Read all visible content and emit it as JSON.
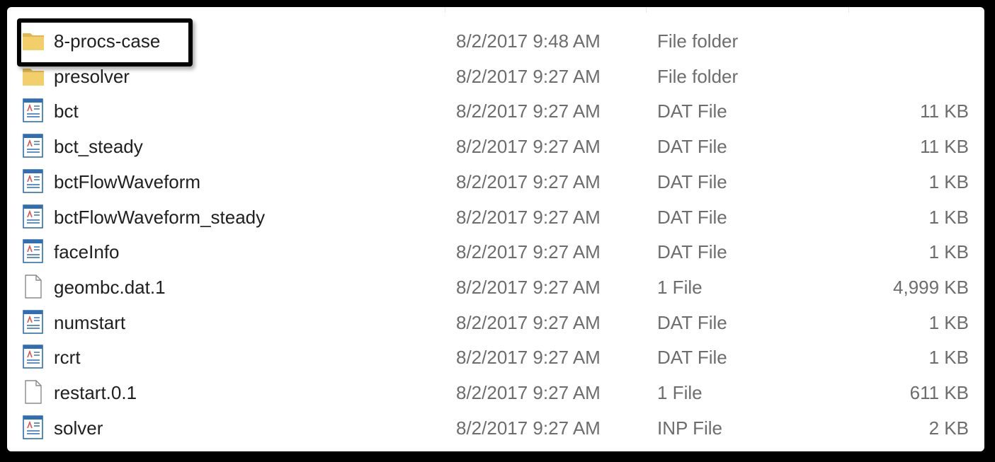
{
  "files": [
    {
      "name": "8-procs-case",
      "date": "8/2/2017 9:48 AM",
      "type": "File folder",
      "size": "",
      "icon": "folder-icon",
      "selected": true
    },
    {
      "name": "presolver",
      "date": "8/2/2017 9:27 AM",
      "type": "File folder",
      "size": "",
      "icon": "folder-icon"
    },
    {
      "name": "bct",
      "date": "8/2/2017 9:27 AM",
      "type": "DAT File",
      "size": "11 KB",
      "icon": "dat-file-icon"
    },
    {
      "name": "bct_steady",
      "date": "8/2/2017 9:27 AM",
      "type": "DAT File",
      "size": "11 KB",
      "icon": "dat-file-icon"
    },
    {
      "name": "bctFlowWaveform",
      "date": "8/2/2017 9:27 AM",
      "type": "DAT File",
      "size": "1 KB",
      "icon": "dat-file-icon"
    },
    {
      "name": "bctFlowWaveform_steady",
      "date": "8/2/2017 9:27 AM",
      "type": "DAT File",
      "size": "1 KB",
      "icon": "dat-file-icon"
    },
    {
      "name": "faceInfo",
      "date": "8/2/2017 9:27 AM",
      "type": "DAT File",
      "size": "1 KB",
      "icon": "dat-file-icon"
    },
    {
      "name": "geombc.dat.1",
      "date": "8/2/2017 9:27 AM",
      "type": "1 File",
      "size": "4,999 KB",
      "icon": "blank-file-icon"
    },
    {
      "name": "numstart",
      "date": "8/2/2017 9:27 AM",
      "type": "DAT File",
      "size": "1 KB",
      "icon": "dat-file-icon"
    },
    {
      "name": "rcrt",
      "date": "8/2/2017 9:27 AM",
      "type": "DAT File",
      "size": "1 KB",
      "icon": "dat-file-icon"
    },
    {
      "name": "restart.0.1",
      "date": "8/2/2017 9:27 AM",
      "type": "1 File",
      "size": "611 KB",
      "icon": "blank-file-icon"
    },
    {
      "name": "solver",
      "date": "8/2/2017 9:27 AM",
      "type": "INP File",
      "size": "2 KB",
      "icon": "inp-file-icon"
    }
  ],
  "colors": {
    "text": "#202020",
    "meta_text": "#6d6d6d",
    "folder": "#f3cf6b",
    "folder_dark": "#e1b650",
    "file_accent": "#2f6db5",
    "highlight_border": "#000000"
  }
}
